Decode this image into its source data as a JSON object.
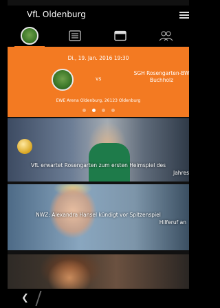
{
  "app": {
    "title": "VfL Oldenburg"
  },
  "tabs": [
    {
      "icon": "club-logo-icon",
      "active": true
    },
    {
      "icon": "news-list-icon",
      "active": false
    },
    {
      "icon": "calendar-icon",
      "active": false
    },
    {
      "icon": "team-icon",
      "active": false
    }
  ],
  "match": {
    "datetime": "Di., 19. Jan. 2016 19:30",
    "vs": "vs",
    "away_line1": "SGH Rosengarten-BW",
    "away_line2": "Buchholz",
    "venue": "EWE Arena Oldenburg, 26123 Oldenburg"
  },
  "carousel": {
    "count": 4,
    "active_index": 1
  },
  "news": [
    {
      "line1": "VfL erwartet Rosengarten zum ersten Heimspiel des",
      "line2": "Jahres"
    },
    {
      "line1": "NWZ: Alexandra Hansel kündigt vor Spitzenspiel",
      "line2": "Hilferuf an"
    },
    {
      "line1": "",
      "line2": ""
    }
  ],
  "colors": {
    "accent": "#f37a22",
    "bar": "#000000"
  },
  "navbar": {
    "back_icon": "back-icon"
  }
}
